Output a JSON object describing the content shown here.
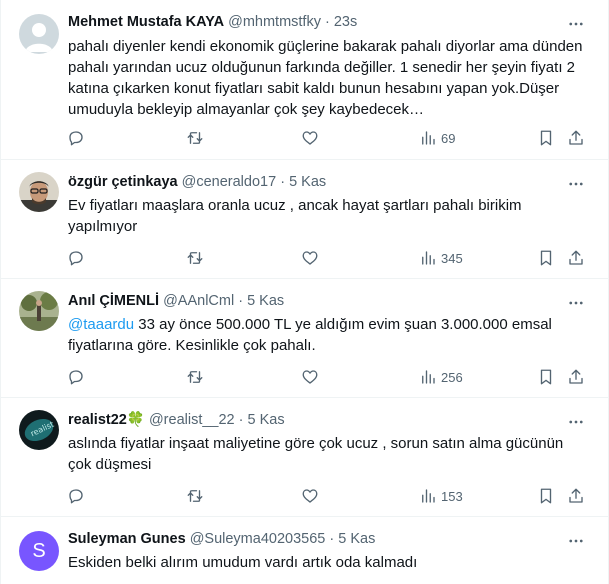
{
  "tweets": [
    {
      "name": "Mehmet Mustafa KAYA",
      "handle": "@mhmtmstfky",
      "time": "23s",
      "mention": "",
      "text": "pahalı diyenler kendi ekonomik güçlerine bakarak pahalı diyorlar ama dünden pahalı yarından ucuz olduğunun farkında değiller. 1 senedir her şeyin fiyatı 2 katına çıkarken konut fiyatları sabit kaldı bunun hesabını yapan yok.Düşer umuduyla bekleyip almayanlar çok şey kaybedecek…",
      "views": "69",
      "avatar": "default-avatar-icon"
    },
    {
      "name": "özgür çetinkaya",
      "handle": "@ceneraldo17",
      "time": "5 Kas",
      "mention": "",
      "text": "Ev fiyatları maaşlara oranla ucuz , ancak hayat şartları pahalı birikim yapılmıyor",
      "views": "345",
      "avatar": "user-photo"
    },
    {
      "name": "Anıl ÇİMENLİ",
      "handle": "@AAnlCml",
      "time": "5 Kas",
      "mention": "@taaardu",
      "text": " 33 ay önce 500.000 TL ye aldığım evim şuan 3.000.000 emsal fiyatlarına göre. Kesinlikle çok pahalı.",
      "views": "256",
      "avatar": "user-photo"
    },
    {
      "name": "realist22",
      "name_emoji": "🍀",
      "handle": "@realist__22",
      "time": "5 Kas",
      "mention": "",
      "text": "aslında fiyatlar inşaat maliyetine göre çok ucuz , sorun satın alma gücünün çok düşmesi",
      "views": "153",
      "avatar": "user-photo"
    },
    {
      "name": "Suleyman Gunes",
      "handle": "@Suleyma40203565",
      "time": "5 Kas",
      "mention": "",
      "text": "Eskiden belki alırım umudum vardı artık oda kalmadı",
      "avatar_letter": "S",
      "avatar_color": "#7856ff",
      "avatar": "letter-avatar"
    }
  ],
  "separator": "·",
  "colors": {
    "link": "#1d9bf0",
    "muted": "#536471",
    "border": "#eff3f4"
  }
}
